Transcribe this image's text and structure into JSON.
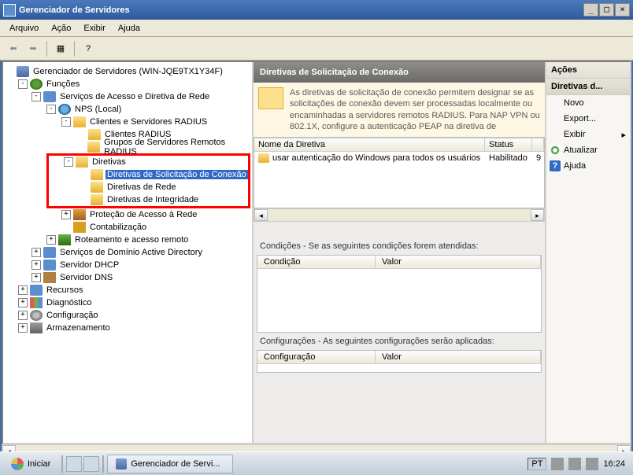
{
  "window": {
    "title": "Gerenciador de Servidores"
  },
  "menus": {
    "file": "Arquivo",
    "action": "Ação",
    "view": "Exibir",
    "help": "Ajuda"
  },
  "tree": {
    "root": "Gerenciador de Servidores (WIN-JQE9TX1Y34F)",
    "funcoes": "Funções",
    "sa": "Serviços de Acesso e Diretiva de Rede",
    "nps": "NPS (Local)",
    "clientes": "Clientes e Servidores RADIUS",
    "clientes_radius": "Clientes RADIUS",
    "grupos_radius": "Grupos de Servidores Remotos RADIUS",
    "diretivas": "Diretivas",
    "dir_conexao": "Diretivas de Solicitação de Conexão",
    "dir_rede": "Diretivas de Rede",
    "dir_integ": "Diretivas de Integridade",
    "protecao": "Proteção de Acesso à Rede",
    "contabilizacao": "Contabilização",
    "roteamento": "Roteamento e acesso remoto",
    "ad": "Serviços de Domínio Active Directory",
    "dhcp": "Servidor DHCP",
    "dns": "Servidor DNS",
    "recursos": "Recursos",
    "diag": "Diagnóstico",
    "config": "Configuração",
    "armaz": "Armazenamento"
  },
  "details": {
    "header": "Diretivas de Solicitação de Conexão",
    "info": "As diretivas de solicitação de conexão permitem designar se as solicitações de conexão devem ser processadas localmente ou encaminhadas a servidores remotos RADIUS. Para NAP VPN ou 802.1X, configure a autenticação PEAP na diretiva de",
    "list": {
      "col_name": "Nome da Diretiva",
      "col_status": "Status",
      "row1_name": "usar autenticação do Windows para todos os usuários",
      "row1_status": "Habilitado",
      "row1_order": "9"
    },
    "cond_title": "Condições - Se as seguintes condições forem atendidas:",
    "cond_col1": "Condição",
    "cond_col2": "Valor",
    "cfg_title": "Configurações - As seguintes configurações serão aplicadas:",
    "cfg_col1": "Configuração",
    "cfg_col2": "Valor"
  },
  "actions": {
    "header": "Ações",
    "subheader": "Diretivas d...",
    "novo": "Novo",
    "export": "Export...",
    "exibir": "Exibir",
    "atualizar": "Atualizar",
    "ajuda": "Ajuda"
  },
  "taskbar": {
    "start": "Iniciar",
    "app": "Gerenciador de Servi...",
    "lang": "PT",
    "clock": "16:24"
  }
}
